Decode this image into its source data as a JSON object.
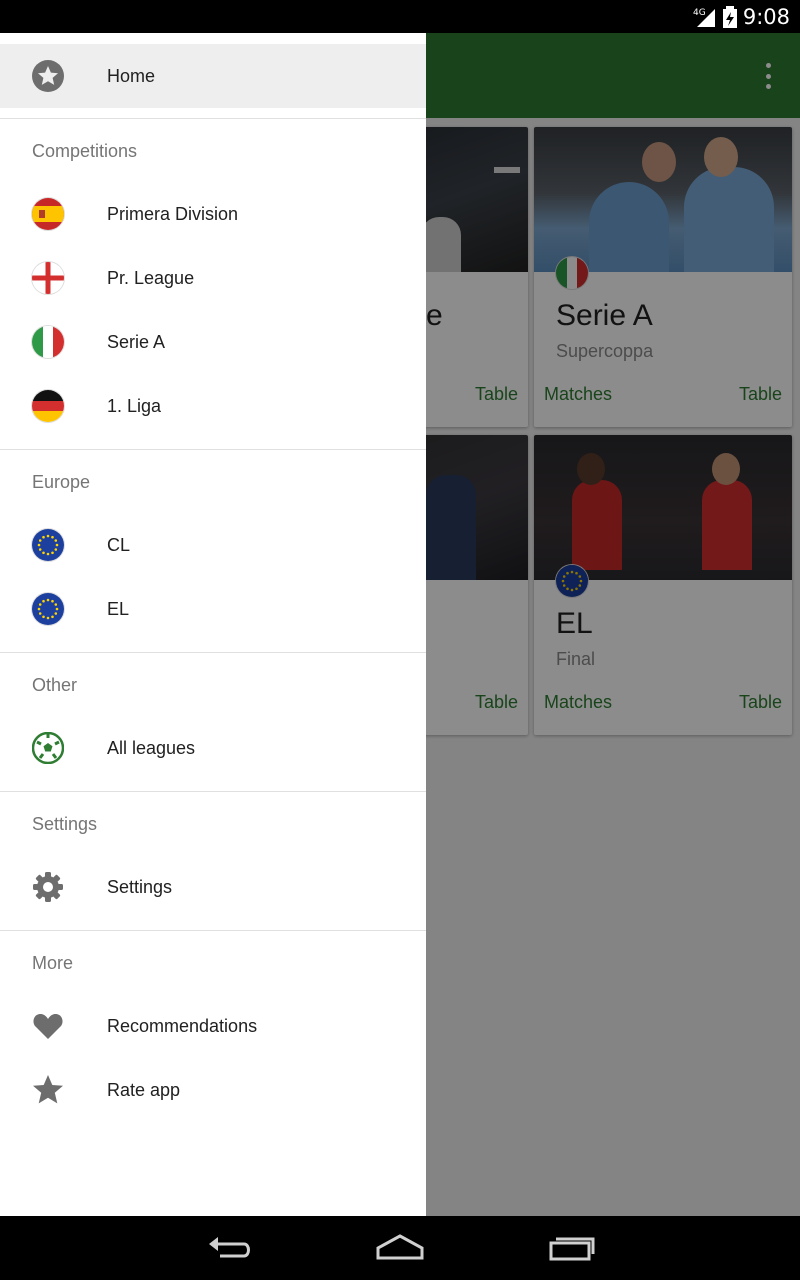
{
  "status": {
    "network": "4G",
    "time": "9:08"
  },
  "app": {
    "cards": [
      {
        "title": "",
        "subtitle": "",
        "matches_label": "",
        "table_label": "Table",
        "flag": "none"
      },
      {
        "title": "Serie A",
        "subtitle": "Supercoppa",
        "matches_label": "Matches",
        "table_label": "Table",
        "flag": "italy"
      },
      {
        "title": "",
        "subtitle": "",
        "matches_label": "",
        "table_label": "Table",
        "flag": "none"
      },
      {
        "title": "EL",
        "subtitle": "Final",
        "matches_label": "Matches",
        "table_label": "Table",
        "flag": "eu"
      }
    ],
    "partial_title_letter": "e"
  },
  "drawer": {
    "home": {
      "label": "Home",
      "icon": "star-circle-icon"
    },
    "competitions": {
      "header": "Competitions",
      "items": [
        {
          "label": "Primera Division",
          "icon": "spain-flag-icon"
        },
        {
          "label": "Pr. League",
          "icon": "england-flag-icon"
        },
        {
          "label": "Serie A",
          "icon": "italy-flag-icon"
        },
        {
          "label": "1. Liga",
          "icon": "germany-flag-icon"
        }
      ]
    },
    "europe": {
      "header": "Europe",
      "items": [
        {
          "label": "CL",
          "icon": "eu-flag-icon"
        },
        {
          "label": "EL",
          "icon": "eu-flag-icon"
        }
      ]
    },
    "other": {
      "header": "Other",
      "items": [
        {
          "label": "All leagues",
          "icon": "soccer-ball-icon"
        }
      ]
    },
    "settings": {
      "header": "Settings",
      "items": [
        {
          "label": "Settings",
          "icon": "gear-icon"
        }
      ]
    },
    "more": {
      "header": "More",
      "items": [
        {
          "label": "Recommendations",
          "icon": "heart-icon"
        },
        {
          "label": "Rate app",
          "icon": "star-icon"
        }
      ]
    }
  },
  "colors": {
    "toolbar": "#2e7d32",
    "accent": "#2e7d32",
    "icon_gray": "#6d6d6d"
  }
}
